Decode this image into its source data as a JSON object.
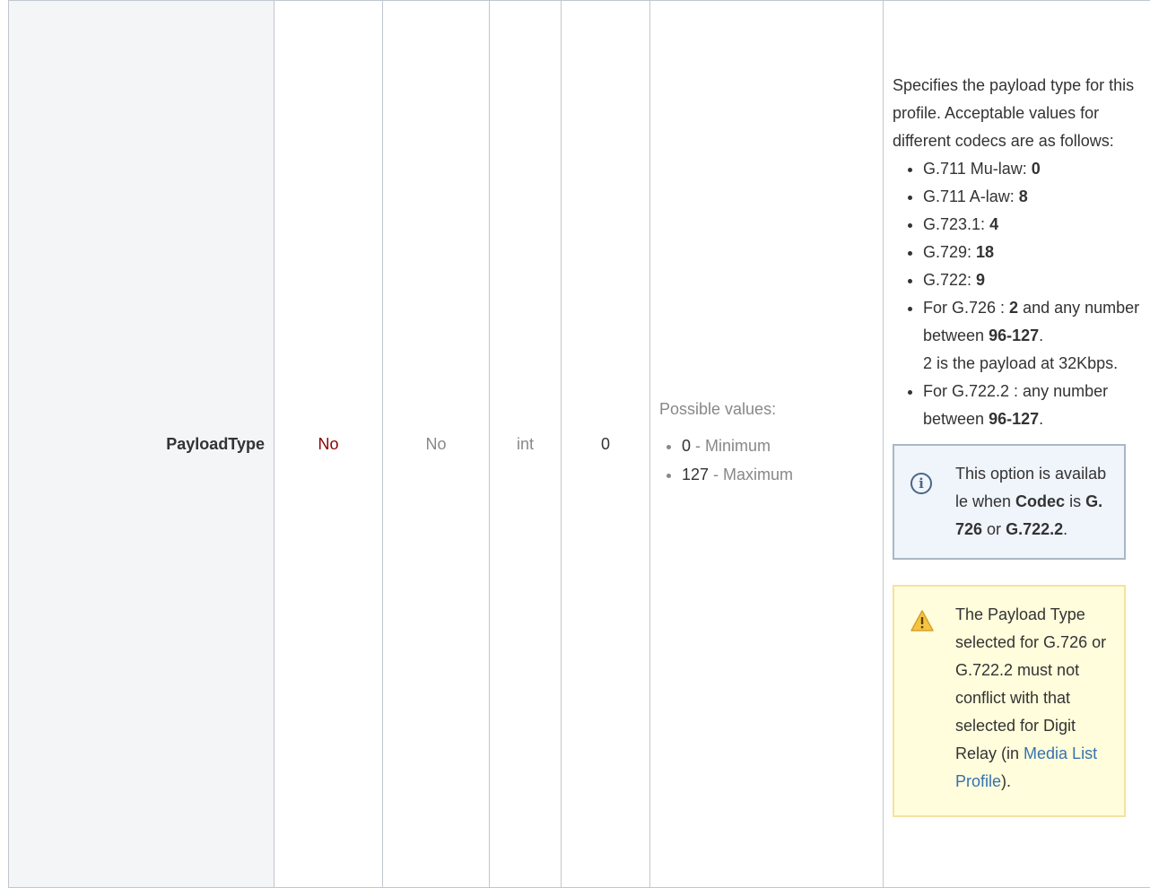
{
  "row": {
    "name": "PayloadType",
    "required": "No",
    "read_only": "No",
    "type": "int",
    "default": "0"
  },
  "range": {
    "label": "Possible values:",
    "items": [
      {
        "value": "0",
        "sep": " - ",
        "text": "Minimum"
      },
      {
        "value": "127",
        "sep": " - ",
        "text": "Maximum"
      }
    ]
  },
  "description": {
    "intro": "Specifies the payload type for this profile. Acceptable values for different codecs are as follows:",
    "codecs": [
      {
        "label": "G.711 Mu-law: ",
        "value": "0"
      },
      {
        "label": "G.711 A-law: ",
        "value": "8"
      },
      {
        "label": "G.723.1: ",
        "value": "4"
      },
      {
        "label": "G.729: ",
        "value": "18"
      },
      {
        "label": "G.722: ",
        "value": "9"
      }
    ],
    "g726": {
      "prefix": "For G.726 : ",
      "v1": "2",
      "mid": " and any number between ",
      "range": "96-127",
      "end": ".",
      "note": "2 is the payload at 32Kbps."
    },
    "g7222": {
      "prefix": "For G.722.2 : any number between ",
      "range": "96-127",
      "end": "."
    },
    "info_panel": {
      "t1": "This option is available when ",
      "b1": "Codec",
      "t2": " is ",
      "b2": "G.726",
      "t3": " or ",
      "b3": "G.722.2",
      "t4": "."
    },
    "warning_panel": {
      "t1": "The Payload Type selected for G.726 or G.722.2 must not conflict with that selected for Digit Relay (in ",
      "link": "Media List Profile",
      "t2": ")."
    }
  }
}
